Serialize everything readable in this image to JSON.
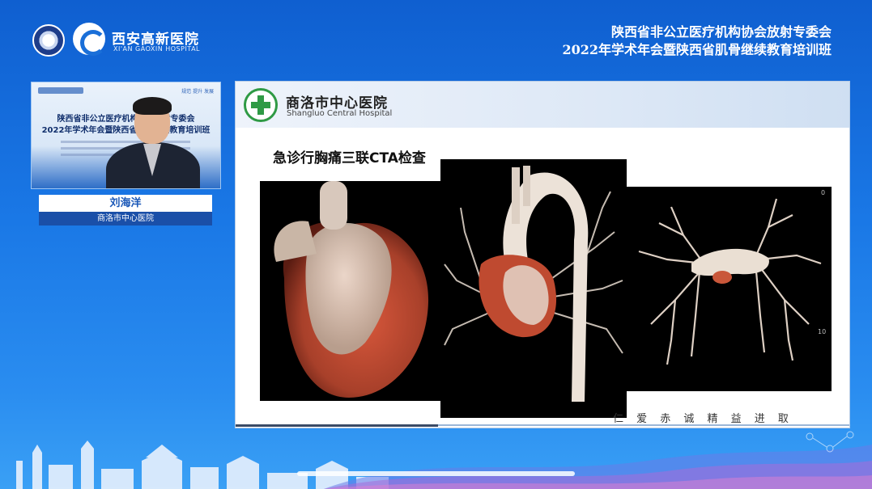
{
  "brand": {
    "name_cn": "西安高新医院",
    "name_en": "XI'AN GAOXIN HOSPITAL"
  },
  "event": {
    "title_line1": "陕西省非公立医疗机构协会放射专委会",
    "title_line2": "2022年学术年会暨陕西省肌骨继续教育培训班"
  },
  "speaker": {
    "name": "刘海洋",
    "hospital": "商洛市中心医院",
    "video": {
      "badge": "西安高新医院",
      "right_text": "规范  提升  发展",
      "line1": "陕西省非公立医疗机构协会放射专委会",
      "line2": "2022年学术年会暨陕西省肌骨继续教育培训班"
    }
  },
  "slide": {
    "hospital_cn": "商洛市中心医院",
    "hospital_en": "Shangluo Central Hospital",
    "heading": "急诊行胸痛三联CTA检查",
    "motto": "仁 爱 赤 诚   精 益 进 取",
    "scan_label_top": "0",
    "scan_label_right": "10"
  },
  "colors": {
    "background": "#1a78e6",
    "slide_green": "#2f9a45",
    "heart_red": "#b8452c"
  }
}
